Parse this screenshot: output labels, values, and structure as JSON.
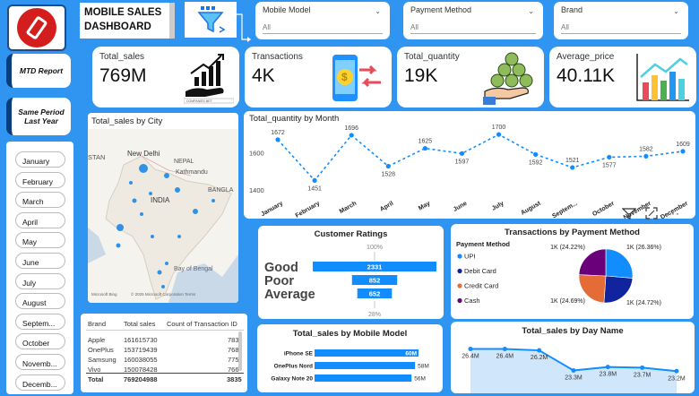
{
  "header": {
    "title_line1": "MOBILE SALES",
    "title_line2": "DASHBOARD"
  },
  "filters": [
    {
      "label": "Mobile Model",
      "value": "All"
    },
    {
      "label": "Payment Method",
      "value": "All"
    },
    {
      "label": "Brand",
      "value": "All"
    }
  ],
  "nav": {
    "mtd": "MTD Report",
    "same_period": "Same Period Last Year"
  },
  "months": [
    "January",
    "February",
    "March",
    "April",
    "May",
    "June",
    "July",
    "August",
    "Septem...",
    "October",
    "Novemb...",
    "Decemb..."
  ],
  "kpis": [
    {
      "label": "Total_sales",
      "value": "769M",
      "icon": "growth-hand-icon",
      "caption": "COMPANIES.NET"
    },
    {
      "label": "Transactions",
      "value": "4K",
      "icon": "mobile-payment-icon"
    },
    {
      "label": "Total_quantity",
      "value": "19K",
      "icon": "coin-stack-hand-icon"
    },
    {
      "label": "Average_price",
      "value": "40.11K",
      "icon": "bar-trend-icon"
    }
  ],
  "map": {
    "title": "Total_sales by City",
    "labels": [
      "New Delhi",
      "NEPAL",
      "Kathmandu",
      "BANGLA",
      "INDIA",
      "Bay of Bengal",
      "STAN"
    ],
    "footer": "© 2025 Microsoft Corporation  Terms",
    "bing": "Microsoft Bing"
  },
  "chart_data": [
    {
      "type": "line",
      "title": "Total_quantity by Month",
      "categories": [
        "January",
        "February",
        "March",
        "April",
        "May",
        "June",
        "July",
        "August",
        "Septem...",
        "October",
        "November",
        "December"
      ],
      "values": [
        1672,
        1451,
        1696,
        1528,
        1625,
        1597,
        1700,
        1592,
        1521,
        1577,
        1582,
        1609
      ],
      "yticks": [
        1400,
        1600
      ],
      "ylim": [
        1380,
        1720
      ]
    },
    {
      "type": "bar",
      "title": "Customer Ratings",
      "categories": [
        "Good",
        "Poor",
        "Average"
      ],
      "values": [
        2331,
        852,
        652
      ],
      "top_pct": "100%",
      "bottom_pct": "28%"
    },
    {
      "type": "pie",
      "title": "Transactions by Payment Method",
      "legend_title": "Payment Method",
      "categories": [
        "UPI",
        "Debit Card",
        "Credit Card",
        "Cash"
      ],
      "values": [
        26.36,
        24.72,
        24.69,
        24.22
      ],
      "labels": [
        "1K (26.36%)",
        "1K (24.72%)",
        "1K (24.69%)",
        "1K (24.22%)"
      ],
      "colors": [
        "#118dff",
        "#12239e",
        "#e66c37",
        "#6b007b"
      ]
    },
    {
      "type": "bar",
      "title": "Total_sales by Mobile Model",
      "categories": [
        "iPhone SE",
        "OnePlus Nord",
        "Galaxy Note 20"
      ],
      "values": [
        60,
        58,
        56
      ],
      "labels": [
        "60M",
        "58M",
        "56M"
      ]
    },
    {
      "type": "area",
      "title": "Total_sales by Day Name",
      "values": [
        26.4,
        26.4,
        26.2,
        23.3,
        23.8,
        23.7,
        23.2
      ],
      "labels": [
        "26.4M",
        "26.4M",
        "26.2M",
        "23.3M",
        "23.8M",
        "23.7M",
        "23.2M"
      ]
    }
  ],
  "table": {
    "headers": [
      "Brand",
      "Total sales",
      "Count of Transaction ID"
    ],
    "rows": [
      [
        "Apple",
        "161615730",
        "783"
      ],
      [
        "OnePlus",
        "153719439",
        "768"
      ],
      [
        "Samsung",
        "160038055",
        "775"
      ],
      [
        "Vivo",
        "150078428",
        "766"
      ]
    ],
    "total": [
      "Total",
      "769204988",
      "3835"
    ]
  },
  "colors": {
    "background": "#2f95f0",
    "accent": "#118dff",
    "dark": "#0b3d7a"
  }
}
